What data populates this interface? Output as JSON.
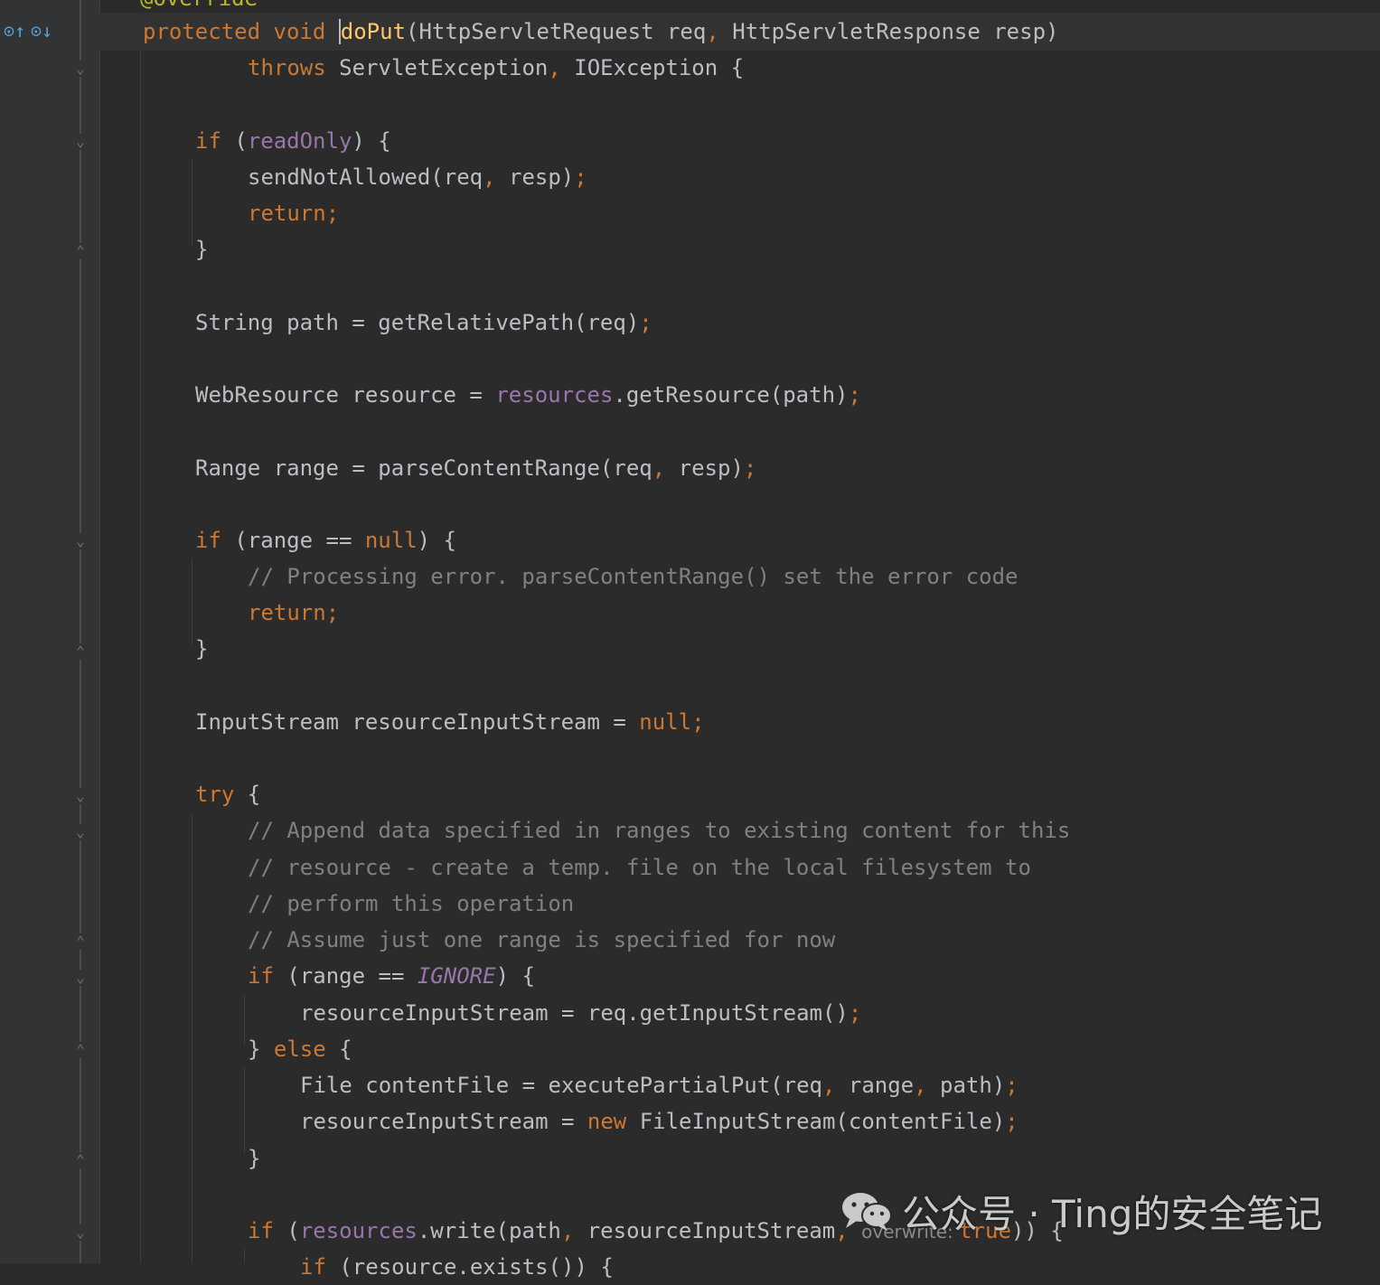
{
  "editor": {
    "annotation_partial": "@Override",
    "inlay_hint_overwrite": "overwrite:",
    "lines": [
      {
        "id": "sig",
        "parts": [
          {
            "t": "protected ",
            "c": "kw"
          },
          {
            "t": "void ",
            "c": "kw"
          },
          {
            "t": "doPut",
            "c": "fn",
            "caret": true
          },
          {
            "t": "(HttpServletRequest req",
            "c": ""
          },
          {
            "t": ", ",
            "c": "kw"
          },
          {
            "t": "HttpServletResponse resp)",
            "c": ""
          }
        ]
      },
      {
        "id": "throws",
        "parts": [
          {
            "t": "throws ",
            "c": "kw"
          },
          {
            "t": "ServletException",
            "c": ""
          },
          {
            "t": ", ",
            "c": "kw"
          },
          {
            "t": "IOException {",
            "c": ""
          }
        ]
      },
      {
        "id": "blank1",
        "parts": []
      },
      {
        "id": "if-readonly",
        "parts": [
          {
            "t": "if ",
            "c": "kw"
          },
          {
            "t": "(",
            "c": ""
          },
          {
            "t": "readOnly",
            "c": "fld"
          },
          {
            "t": ") {",
            "c": ""
          }
        ]
      },
      {
        "id": "send-not-allowed",
        "parts": [
          {
            "t": "sendNotAllowed(req",
            "c": ""
          },
          {
            "t": ", ",
            "c": "kw"
          },
          {
            "t": "resp)",
            "c": ""
          },
          {
            "t": ";",
            "c": "kw"
          }
        ]
      },
      {
        "id": "return1",
        "parts": [
          {
            "t": "return;",
            "c": "kw"
          }
        ]
      },
      {
        "id": "close1",
        "parts": [
          {
            "t": "}",
            "c": ""
          }
        ]
      },
      {
        "id": "blank2",
        "parts": []
      },
      {
        "id": "path",
        "parts": [
          {
            "t": "String path = getRelativePath(req)",
            "c": ""
          },
          {
            "t": ";",
            "c": "kw"
          }
        ]
      },
      {
        "id": "blank3",
        "parts": []
      },
      {
        "id": "resource",
        "parts": [
          {
            "t": "WebResource resource = ",
            "c": ""
          },
          {
            "t": "resources",
            "c": "fld"
          },
          {
            "t": ".getResource(path)",
            "c": ""
          },
          {
            "t": ";",
            "c": "kw"
          }
        ]
      },
      {
        "id": "blank4",
        "parts": []
      },
      {
        "id": "range",
        "parts": [
          {
            "t": "Range range = parseContentRange(req",
            "c": ""
          },
          {
            "t": ", ",
            "c": "kw"
          },
          {
            "t": "resp)",
            "c": ""
          },
          {
            "t": ";",
            "c": "kw"
          }
        ]
      },
      {
        "id": "blank5",
        "parts": []
      },
      {
        "id": "if-range-null",
        "parts": [
          {
            "t": "if ",
            "c": "kw"
          },
          {
            "t": "(range == ",
            "c": ""
          },
          {
            "t": "null",
            "c": "kw"
          },
          {
            "t": ") {",
            "c": ""
          }
        ]
      },
      {
        "id": "comment1",
        "parts": [
          {
            "t": "// Processing error. parseContentRange() set the error code",
            "c": "cm"
          }
        ]
      },
      {
        "id": "return2",
        "parts": [
          {
            "t": "return;",
            "c": "kw"
          }
        ]
      },
      {
        "id": "close2",
        "parts": [
          {
            "t": "}",
            "c": ""
          }
        ]
      },
      {
        "id": "blank6",
        "parts": []
      },
      {
        "id": "input-stream",
        "parts": [
          {
            "t": "InputStream resourceInputStream = ",
            "c": ""
          },
          {
            "t": "null;",
            "c": "kw"
          }
        ]
      },
      {
        "id": "blank7",
        "parts": []
      },
      {
        "id": "try",
        "parts": [
          {
            "t": "try ",
            "c": "kw"
          },
          {
            "t": "{",
            "c": ""
          }
        ]
      },
      {
        "id": "comment2",
        "parts": [
          {
            "t": "// Append data specified in ranges to existing content for this",
            "c": "cm"
          }
        ]
      },
      {
        "id": "comment3",
        "parts": [
          {
            "t": "// resource - create a temp. file on the local filesystem to",
            "c": "cm"
          }
        ]
      },
      {
        "id": "comment4",
        "parts": [
          {
            "t": "// perform this operation",
            "c": "cm"
          }
        ]
      },
      {
        "id": "comment5",
        "parts": [
          {
            "t": "// Assume just one range is specified for now",
            "c": "cm"
          }
        ]
      },
      {
        "id": "if-ignore",
        "parts": [
          {
            "t": "if ",
            "c": "kw"
          },
          {
            "t": "(range == ",
            "c": ""
          },
          {
            "t": "IGNORE",
            "c": "cnst"
          },
          {
            "t": ") {",
            "c": ""
          }
        ]
      },
      {
        "id": "get-input-stream",
        "parts": [
          {
            "t": "resourceInputStream = req.getInputStream()",
            "c": ""
          },
          {
            "t": ";",
            "c": "kw"
          }
        ]
      },
      {
        "id": "else",
        "parts": [
          {
            "t": "} ",
            "c": ""
          },
          {
            "t": "else ",
            "c": "kw"
          },
          {
            "t": "{",
            "c": ""
          }
        ]
      },
      {
        "id": "content-file",
        "parts": [
          {
            "t": "File contentFile = executePartialPut(req",
            "c": ""
          },
          {
            "t": ", ",
            "c": "kw"
          },
          {
            "t": "range",
            "c": ""
          },
          {
            "t": ", ",
            "c": "kw"
          },
          {
            "t": "path)",
            "c": ""
          },
          {
            "t": ";",
            "c": "kw"
          }
        ]
      },
      {
        "id": "file-input-stream",
        "parts": [
          {
            "t": "resourceInputStream = ",
            "c": ""
          },
          {
            "t": "new ",
            "c": "kw"
          },
          {
            "t": "FileInputStream(contentFile)",
            "c": ""
          },
          {
            "t": ";",
            "c": "kw"
          }
        ]
      },
      {
        "id": "close3",
        "parts": [
          {
            "t": "}",
            "c": ""
          }
        ]
      },
      {
        "id": "blank8",
        "parts": []
      },
      {
        "id": "if-write",
        "parts": [
          {
            "t": "if ",
            "c": "kw"
          },
          {
            "t": "(",
            "c": ""
          },
          {
            "t": "resources",
            "c": "fld"
          },
          {
            "t": ".write(path",
            "c": ""
          },
          {
            "t": ", ",
            "c": "kw"
          },
          {
            "t": "resourceInputStream",
            "c": ""
          },
          {
            "t": ", ",
            "c": "kw"
          },
          {
            "t": "overwrite: ",
            "c": "hint"
          },
          {
            "t": "true",
            "c": "kw"
          },
          {
            "t": ")) {",
            "c": ""
          }
        ]
      },
      {
        "id": "if-exists-partial",
        "parts": [
          {
            "t": "if ",
            "c": "kw"
          },
          {
            "t": "(resource.exists()) {",
            "c": ""
          }
        ]
      }
    ]
  },
  "watermark": {
    "text": "公众号 · Ting的安全笔记"
  }
}
